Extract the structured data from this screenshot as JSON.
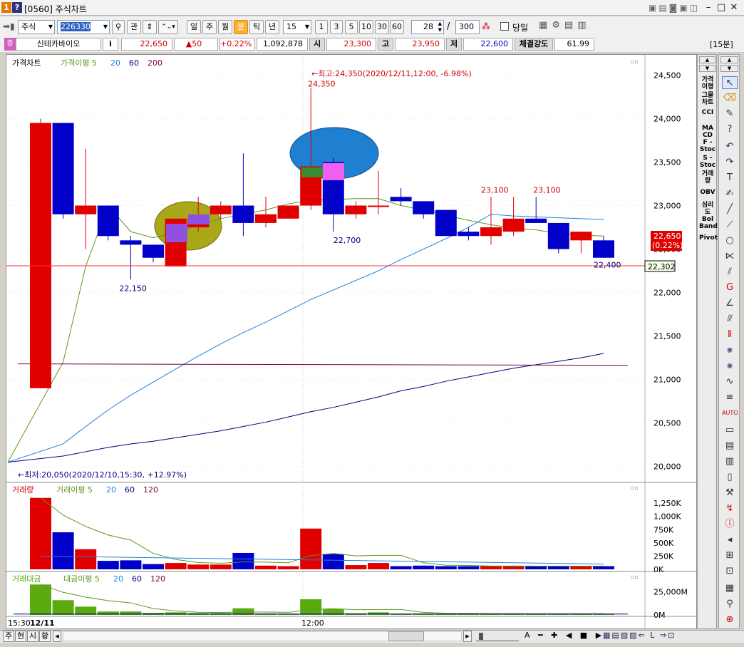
{
  "window": {
    "num_badge": "1",
    "help_badge": "?",
    "title": "[0560] 주식차트",
    "min": "–",
    "max": "□",
    "close": "✕"
  },
  "toolbar": {
    "market": "주식",
    "code": "226330",
    "gwan": "관",
    "periods": [
      "일",
      "주",
      "월",
      "분",
      "틱",
      "년"
    ],
    "selected_period": "분",
    "interval": "15",
    "minutes": [
      "1",
      "3",
      "5",
      "10",
      "30",
      "60"
    ],
    "count": "28",
    "slash": "/",
    "total": "300",
    "today_label": "당일"
  },
  "info": {
    "name": "신테카바이오",
    "i": "i",
    "price": "22,650",
    "change": "▲50",
    "change_pct": "+0.22%",
    "volume": "1,092,878",
    "open_label": "시",
    "open": "23,300",
    "high_label": "고",
    "high": "23,950",
    "low_label": "저",
    "low": "22,600",
    "strength_label": "체결강도",
    "strength": "61.99",
    "period_badge": "[15분]"
  },
  "price_panel": {
    "legend": {
      "title": "가격차트",
      "ma": "가격이평 5",
      "p20": "20",
      "p60": "60",
      "p200": "200"
    },
    "high_note": "←최고:24,350(2020/12/11,12:00, -6.98%)",
    "low_note": "←최저:20,050(2020/12/10,15:30, +12.97%)",
    "last_price": "22,650",
    "last_pct": "(0.22%)",
    "cursor_price": "22,302",
    "y_ticks": [
      "24,500",
      "24,000",
      "23,500",
      "23,000",
      "22,500",
      "22,000",
      "21,500",
      "21,000",
      "20,500",
      "20,000"
    ],
    "labels": [
      "24,350",
      "22,150",
      "22,700",
      "23,100",
      "23,100",
      "22,400"
    ]
  },
  "volume_panel": {
    "legend": {
      "title": "거래량",
      "ma": "거래이평 5",
      "p20": "20",
      "p60": "60",
      "p120": "120"
    },
    "y_ticks": [
      "1,250K",
      "1,000K",
      "750K",
      "500K",
      "250K",
      "0K"
    ]
  },
  "amount_panel": {
    "legend": {
      "title": "거래대금",
      "ma": "대금이평 5",
      "p20": "20",
      "p60": "60",
      "p120": "120"
    },
    "y_ticks": [
      "25,000M",
      "0M"
    ]
  },
  "x_axis": {
    "start": "15:30",
    "date": "12/11",
    "mid": "12:00"
  },
  "indicators": [
    "가격\n이평",
    "그물\n차트",
    "CCI",
    "MA\nCD",
    "F -\nStoc",
    "S -\nStoc",
    "거래\n량",
    "OBV",
    "심리\n도",
    "Bol\nBand",
    "Pivot"
  ],
  "bottom_tabs": [
    "주",
    "현",
    "시",
    "황"
  ],
  "chart_data": {
    "type": "candlestick",
    "interval": "15분",
    "candles": [
      {
        "o": 20900,
        "h": 24000,
        "l": 20900,
        "c": 23950
      },
      {
        "o": 23950,
        "h": 23950,
        "l": 22850,
        "c": 22900
      },
      {
        "o": 22900,
        "h": 23650,
        "l": 22500,
        "c": 23000
      },
      {
        "o": 23000,
        "h": 23000,
        "l": 22600,
        "c": 22650
      },
      {
        "o": 22600,
        "h": 22650,
        "l": 22150,
        "c": 22550
      },
      {
        "o": 22550,
        "h": 22550,
        "l": 22350,
        "c": 22400
      },
      {
        "o": 22300,
        "h": 22850,
        "l": 22300,
        "c": 22850
      },
      {
        "o": 22750,
        "h": 23100,
        "l": 22700,
        "c": 22850
      },
      {
        "o": 22900,
        "h": 23050,
        "l": 22850,
        "c": 23000
      },
      {
        "o": 23000,
        "h": 23600,
        "l": 22650,
        "c": 22800
      },
      {
        "o": 22800,
        "h": 23100,
        "l": 22750,
        "c": 22900
      },
      {
        "o": 22850,
        "h": 23000,
        "l": 22850,
        "c": 23000
      },
      {
        "o": 23000,
        "h": 24350,
        "l": 22950,
        "c": 23450
      },
      {
        "o": 23500,
        "h": 23550,
        "l": 22700,
        "c": 22900
      },
      {
        "o": 22900,
        "h": 23050,
        "l": 22850,
        "c": 23000
      },
      {
        "o": 23000,
        "h": 23400,
        "l": 22900,
        "c": 23000
      },
      {
        "o": 23100,
        "h": 23200,
        "l": 23000,
        "c": 23050
      },
      {
        "o": 23050,
        "h": 23050,
        "l": 22850,
        "c": 22900
      },
      {
        "o": 22950,
        "h": 22950,
        "l": 22650,
        "c": 22650
      },
      {
        "o": 22700,
        "h": 22750,
        "l": 22600,
        "c": 22650
      },
      {
        "o": 22650,
        "h": 23100,
        "l": 22550,
        "c": 22750
      },
      {
        "o": 22700,
        "h": 23100,
        "l": 22650,
        "c": 22850
      },
      {
        "o": 22850,
        "h": 23100,
        "l": 22800,
        "c": 22800
      },
      {
        "o": 22800,
        "h": 22800,
        "l": 22450,
        "c": 22500
      },
      {
        "o": 22600,
        "h": 22700,
        "l": 22450,
        "c": 22700
      },
      {
        "o": 22600,
        "h": 22650,
        "l": 22400,
        "c": 22400
      }
    ],
    "volume_k": [
      1350,
      700,
      380,
      160,
      170,
      100,
      120,
      90,
      90,
      310,
      70,
      60,
      770,
      290,
      80,
      120,
      60,
      70,
      60,
      60,
      60,
      60,
      60,
      60,
      60,
      60
    ],
    "amount_m": [
      33000,
      16000,
      9000,
      3700,
      3700,
      2300,
      2800,
      2000,
      2000,
      7200,
      1600,
      1400,
      17000,
      6600,
      1800,
      2800,
      1400,
      1600,
      1400,
      1400,
      1400,
      1400,
      1400,
      1400,
      1400,
      1400
    ],
    "ma5": [
      20050,
      21200,
      22300,
      23000,
      22700,
      22630,
      22690,
      22770,
      22850,
      22900,
      22950,
      23020,
      23060,
      23070,
      23080,
      23080,
      23000,
      22950,
      22890,
      22830,
      22780,
      22740,
      22720,
      22680,
      22660,
      22650
    ],
    "ma20": [
      20050,
      20260,
      20460,
      20650,
      20820,
      20970,
      21120,
      21270,
      21410,
      21540,
      21660,
      21790,
      21920,
      22030,
      22140,
      22250,
      22380,
      22500,
      22620,
      22750,
      22900,
      22880,
      22870,
      22860,
      22850,
      22840
    ],
    "ma60": [
      20050,
      20120,
      20170,
      20220,
      20260,
      20290,
      20330,
      20370,
      20410,
      20460,
      20510,
      20570,
      20630,
      20680,
      20740,
      20800,
      20870,
      20920,
      20980,
      21030,
      21080,
      21130,
      21170,
      21210,
      21250,
      21300
    ],
    "ma200": [
      21180,
      21180,
      21180,
      21180,
      21180,
      21180,
      21180,
      21180,
      21180,
      21180,
      21180,
      21180,
      21180,
      21180,
      21180,
      21180,
      21180,
      21180,
      21180,
      21180,
      21180,
      21180,
      21180,
      21180,
      21180,
      21180
    ],
    "y_range": [
      19850,
      24700
    ],
    "colors": {
      "up": "#e00000",
      "down": "#0000c8",
      "ma5": "#5a9a1a",
      "ma20": "#2080e0",
      "ma60": "#000080",
      "ma200": "#800040",
      "vol_up": "#e00000",
      "vol_down": "#0000c8",
      "amount": "#5aaa10"
    }
  }
}
